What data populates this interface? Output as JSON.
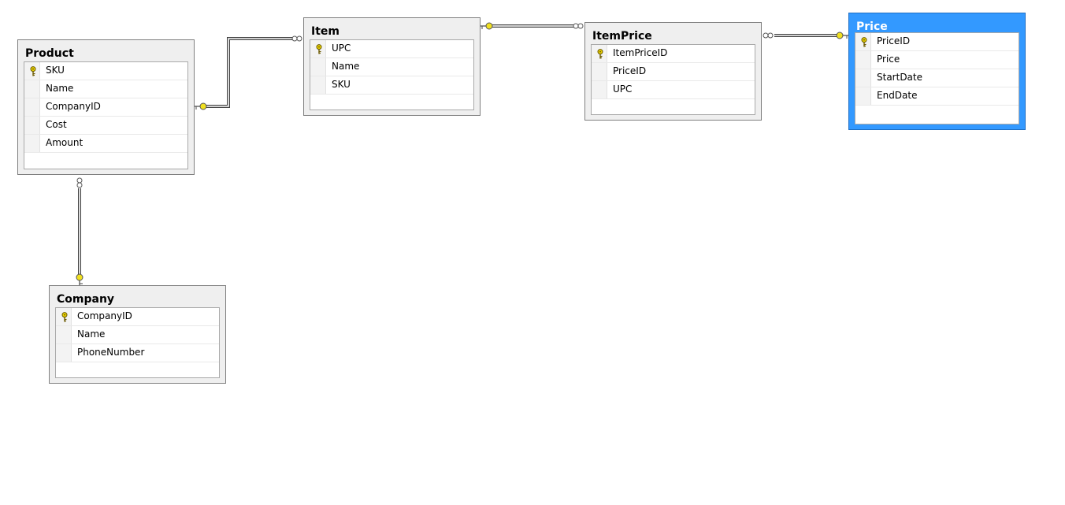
{
  "tables": {
    "product": {
      "name": "Product",
      "columns": [
        {
          "name": "SKU",
          "key": true
        },
        {
          "name": "Name",
          "key": false
        },
        {
          "name": "CompanyID",
          "key": false
        },
        {
          "name": "Cost",
          "key": false
        },
        {
          "name": "Amount",
          "key": false
        }
      ]
    },
    "item": {
      "name": "Item",
      "columns": [
        {
          "name": "UPC",
          "key": true
        },
        {
          "name": "Name",
          "key": false
        },
        {
          "name": "SKU",
          "key": false
        }
      ]
    },
    "itemprice": {
      "name": "ItemPrice",
      "columns": [
        {
          "name": "ItemPriceID",
          "key": true
        },
        {
          "name": "PriceID",
          "key": false
        },
        {
          "name": "UPC",
          "key": false
        }
      ]
    },
    "price": {
      "name": "Price",
      "selected": true,
      "columns": [
        {
          "name": "PriceID",
          "key": true
        },
        {
          "name": "Price",
          "key": false
        },
        {
          "name": "StartDate",
          "key": false
        },
        {
          "name": "EndDate",
          "key": false
        }
      ]
    },
    "company": {
      "name": "Company",
      "columns": [
        {
          "name": "CompanyID",
          "key": true
        },
        {
          "name": "Name",
          "key": false
        },
        {
          "name": "PhoneNumber",
          "key": false
        }
      ]
    }
  },
  "relationships": [
    {
      "name": "product-item",
      "one": "Product",
      "many": "Item"
    },
    {
      "name": "item-itemprice",
      "one": "Item",
      "many": "ItemPrice"
    },
    {
      "name": "price-itemprice",
      "one": "Price",
      "many": "ItemPrice"
    },
    {
      "name": "company-product",
      "one": "Company",
      "many": "Product"
    }
  ],
  "colors": {
    "selected_header": "#3399ff",
    "key_icon": "#e8d000",
    "table_bg": "#efefef"
  }
}
